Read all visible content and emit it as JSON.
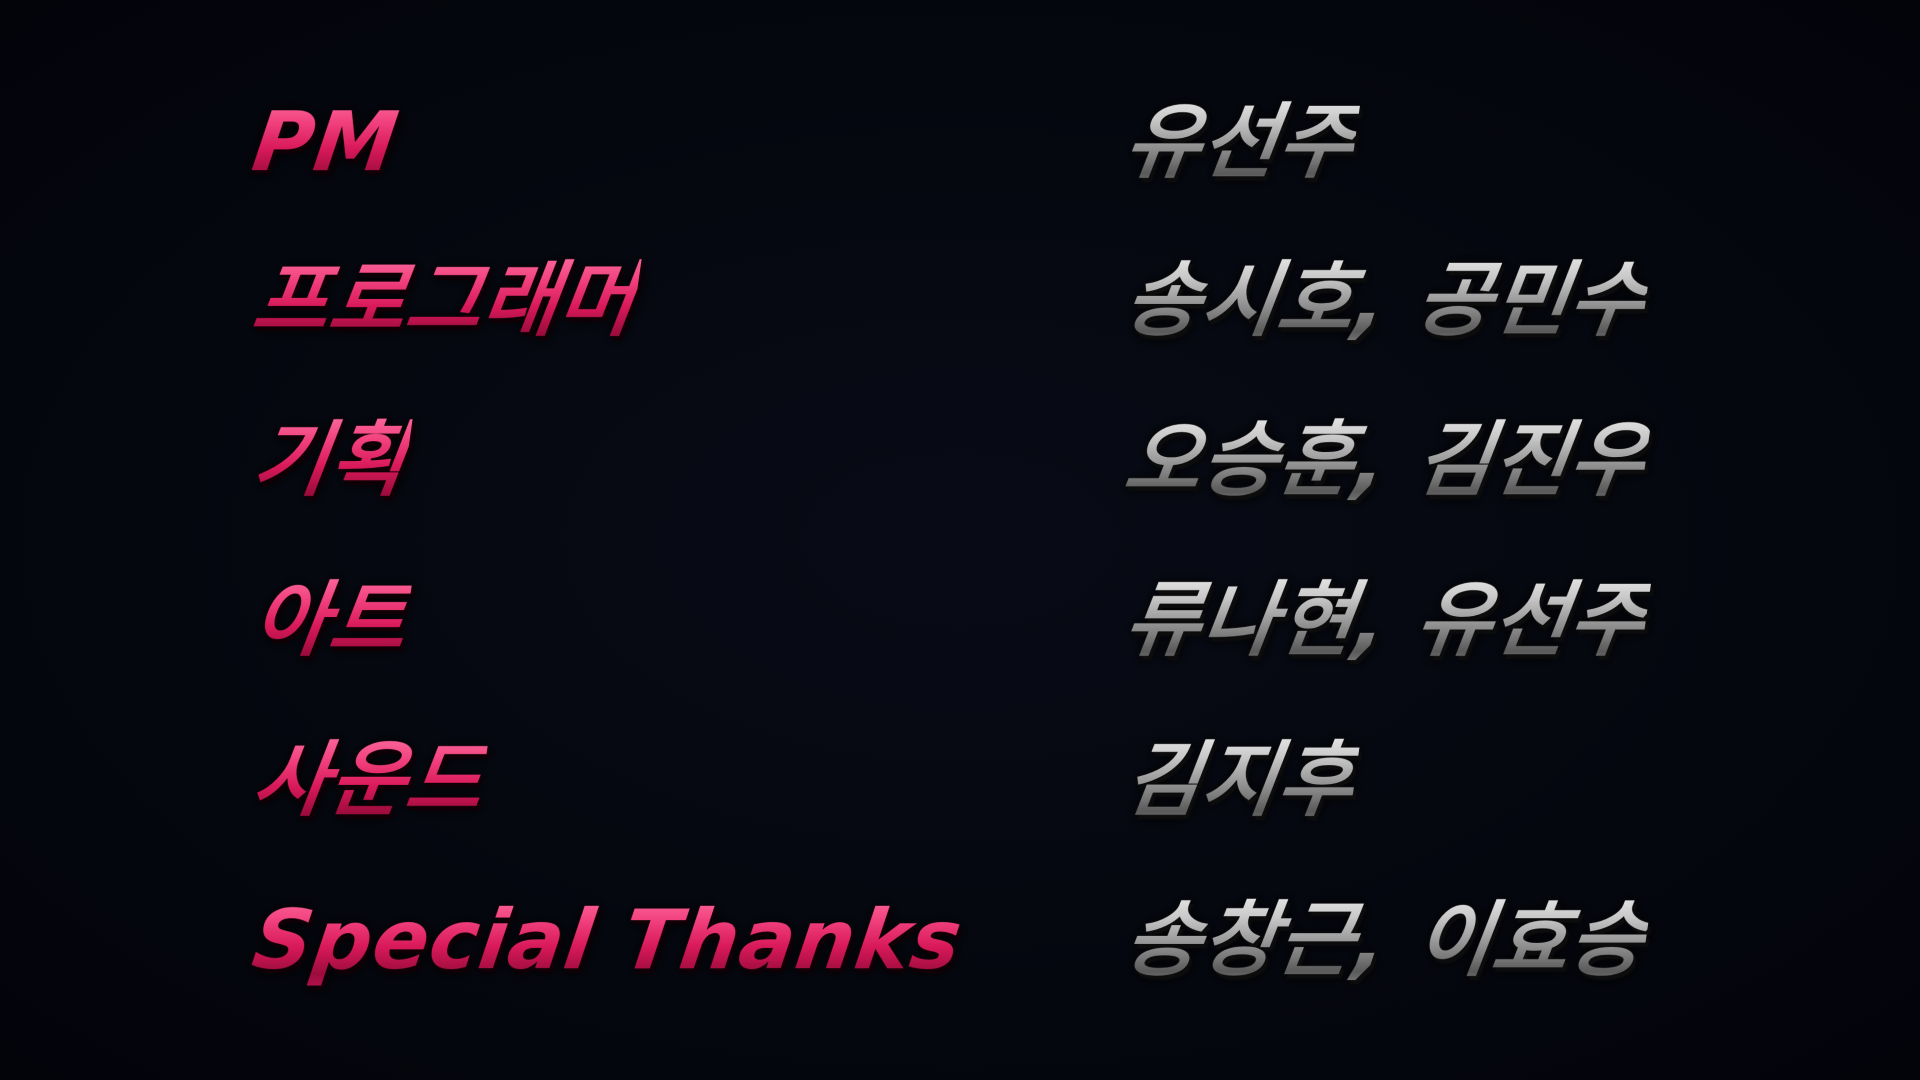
{
  "credits": [
    {
      "role": "PM",
      "names": "유선주"
    },
    {
      "role": "프로그래머",
      "names": "송시호, 공민수"
    },
    {
      "role": "기획",
      "names": "오승훈, 김진우"
    },
    {
      "role": "아트",
      "names": "류나현, 유선주"
    },
    {
      "role": "사운드",
      "names": "김지후"
    },
    {
      "role": "Special Thanks",
      "names": "송창근, 이효승"
    }
  ],
  "colors": {
    "background": "#05070f",
    "role_text": "#e0245e",
    "name_text": "#9a9a9a"
  }
}
